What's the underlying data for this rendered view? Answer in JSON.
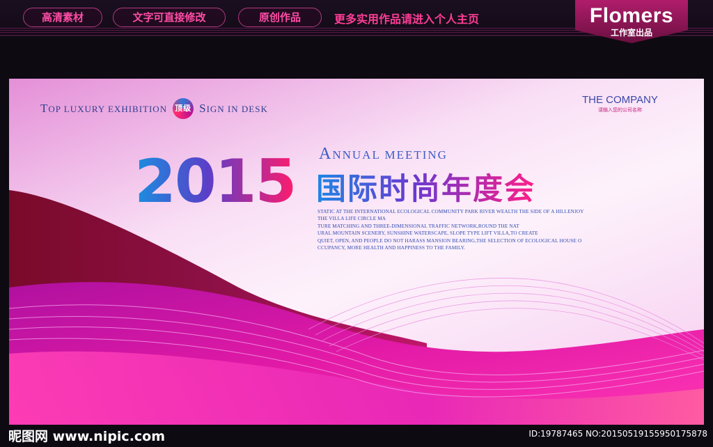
{
  "topbar": {
    "pills": [
      "高清素材",
      "文字可直接修改",
      "原创作品"
    ],
    "slogan": "更多实用作品请进入个人主页",
    "brand_name": "Flomers",
    "brand_sub": "工作室出品"
  },
  "banner": {
    "tagline_parts": [
      "T",
      "OP LUXURY EXHIBITION",
      "顶级",
      "S",
      "IGN IN DESK"
    ],
    "company_name": "THE COMPANY",
    "company_tip": "请输入您的公司名称",
    "year": "2015",
    "annual_cap": "A",
    "annual_rest": "NNUAL MEETING",
    "title": "国际时尚年度会",
    "description_lines": [
      "STATIC AT THE INTERNATIONAL ECOLOGICAL COMMUNITY PARK RIVER WEALTH THE SIDE OF A HILLENJOY",
      "THE VILLA LIFE CIRCLE MA",
      "TURE MATCHING AND THREE-DIMENSIONAL TRAFFIC NETWORK,ROUND THE NAT",
      "URAL MOUNTAIN SCENERY, SUNSHINE WATERSCAPE, SLOPE TYPE LIFT VILLA,TO CREATE",
      "QUIET, OPEN, AND PEOPLE DO NOT HARASS MANSION BEARING,THE SELECTION OF ECOLOGICAL HOUSE O",
      "CCUPANCY, MORE HEALTH AND HAPPINESS TO THE FAMILY."
    ]
  },
  "footer": {
    "watermark": "昵图网 www.nipic.com",
    "image_id": "ID:19787465 NO:20150519155950175878"
  },
  "colors": {
    "accent_pink": "#ff3d96",
    "title_blue": "#1e86e4",
    "title_magenta": "#ff1e86",
    "banner_magenta": "#d0189b"
  }
}
